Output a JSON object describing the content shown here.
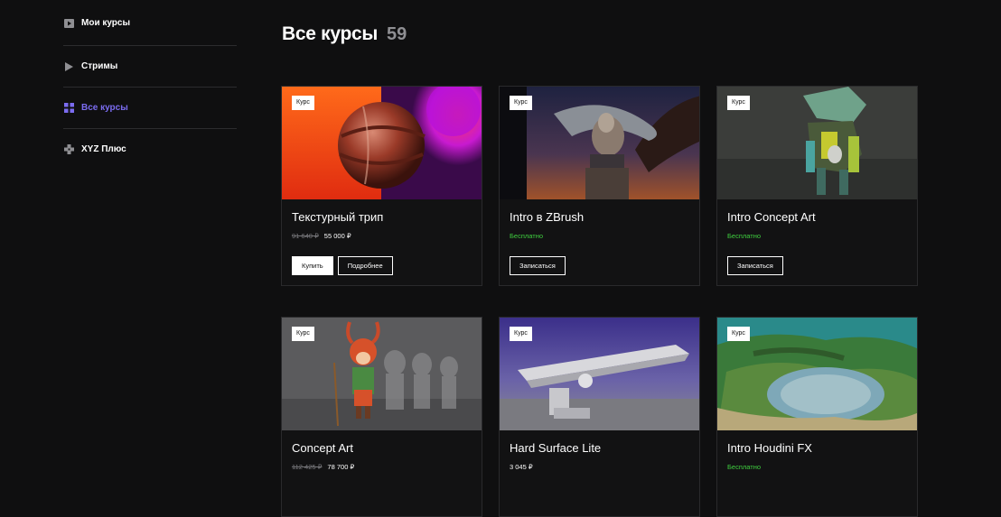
{
  "sidebar": {
    "items": [
      {
        "label": "Мои курсы",
        "icon": "play-box-icon",
        "active": false
      },
      {
        "label": "Стримы",
        "icon": "play-triangle-icon",
        "active": false
      },
      {
        "label": "Все курсы",
        "icon": "grid-icon",
        "active": true
      },
      {
        "label": "XYZ Плюс",
        "icon": "gamepad-icon",
        "active": false
      }
    ]
  },
  "header": {
    "title": "Все курсы",
    "count": "59"
  },
  "colors": {
    "accent": "#7b6cf0",
    "free": "#3fcf3f",
    "background": "#0f0f10"
  },
  "cards": [
    {
      "badge": "Курс",
      "title": "Текстурный трип",
      "old_price": "91 640 ₽",
      "price": "55 000 ₽",
      "free": "",
      "buttons": [
        "Купить",
        "Подробнее"
      ]
    },
    {
      "badge": "Курс",
      "title": "Intro в ZBrush",
      "old_price": "",
      "price": "",
      "free": "Бесплатно",
      "buttons": [
        "Записаться"
      ]
    },
    {
      "badge": "Курс",
      "title": "Intro Concept Art",
      "old_price": "",
      "price": "",
      "free": "Бесплатно",
      "buttons": [
        "Записаться"
      ]
    },
    {
      "badge": "Курс",
      "title": "Concept Art",
      "old_price": "112 425 ₽",
      "price": "78 700 ₽",
      "free": "",
      "buttons": []
    },
    {
      "badge": "Курс",
      "title": "Hard Surface Lite",
      "old_price": "",
      "price": "3 045 ₽",
      "free": "",
      "buttons": []
    },
    {
      "badge": "Курс",
      "title": "Intro Houdini FX",
      "old_price": "",
      "price": "",
      "free": "Бесплатно",
      "buttons": []
    }
  ]
}
